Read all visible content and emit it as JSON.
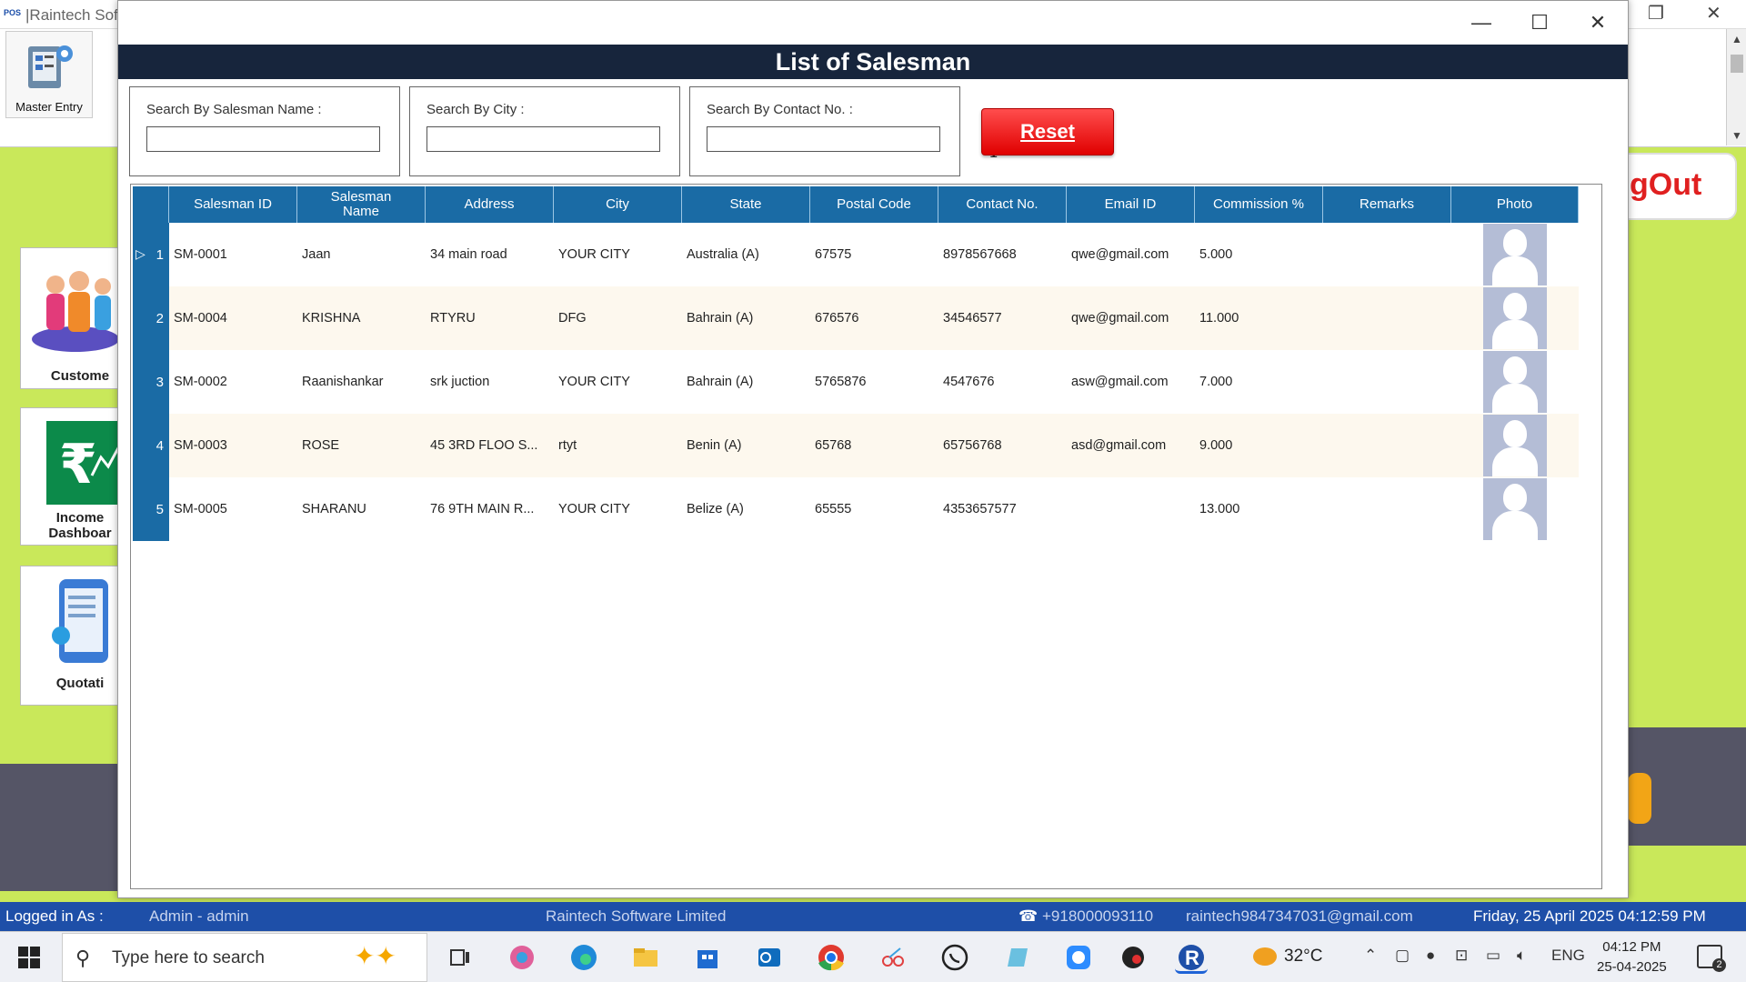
{
  "background_app": {
    "title": "|Raintech Sof",
    "pos_logo": "POS",
    "master_entry_label": "Master Entry",
    "cards": [
      {
        "label": "Custome"
      },
      {
        "label": "Income\nDashboar"
      },
      {
        "label": "Quotati"
      }
    ],
    "logout_label": "gOut"
  },
  "modal": {
    "title": "List of Salesman",
    "search": {
      "name_label": "Search By Salesman Name :",
      "name_value": "",
      "city_label": "Search By City :",
      "city_value": "",
      "contact_label": "Search By Contact No. :",
      "contact_value": ""
    },
    "reset_label": "Reset",
    "columns": [
      "Salesman ID",
      "Salesman Name",
      "Address",
      "City",
      "State",
      "Postal Code",
      "Contact No.",
      "Email ID",
      "Commission %",
      "Remarks",
      "Photo"
    ],
    "rows": [
      {
        "n": "1",
        "id": "SM-0001",
        "name": "Jaan",
        "address": "34 main road",
        "city": "YOUR CITY",
        "state": "Australia (A)",
        "postal": "67575",
        "contact": "8978567668",
        "email": "qwe@gmail.com",
        "commission": "5.000",
        "remarks": ""
      },
      {
        "n": "2",
        "id": "SM-0004",
        "name": "KRISHNA",
        "address": "RTYRU",
        "city": "DFG",
        "state": "Bahrain (A)",
        "postal": "676576",
        "contact": "34546577",
        "email": "qwe@gmail.com",
        "commission": "11.000",
        "remarks": ""
      },
      {
        "n": "3",
        "id": "SM-0002",
        "name": "Raanishankar",
        "address": "srk juction",
        "city": "YOUR CITY",
        "state": "Bahrain (A)",
        "postal": "5765876",
        "contact": "4547676",
        "email": "asw@gmail.com",
        "commission": "7.000",
        "remarks": ""
      },
      {
        "n": "4",
        "id": "SM-0003",
        "name": "ROSE",
        "address": "45 3RD FLOO S...",
        "city": "rtyt",
        "state": "Benin (A)",
        "postal": "65768",
        "contact": "65756768",
        "email": "asd@gmail.com",
        "commission": "9.000",
        "remarks": ""
      },
      {
        "n": "5",
        "id": "SM-0005",
        "name": "SHARANU",
        "address": "76 9TH MAIN R...",
        "city": "YOUR CITY",
        "state": "Belize (A)",
        "postal": "65555",
        "contact": "4353657577",
        "email": "",
        "commission": "13.000",
        "remarks": ""
      }
    ]
  },
  "statusbar": {
    "logged_in": "Logged in As :",
    "user": "Admin - admin",
    "company": "Raintech Software Limited",
    "phone": "+918000093110",
    "email": "raintech9847347031@gmail.com",
    "datetime": "Friday, 25 April 2025 04:12:59 PM"
  },
  "taskbar": {
    "search_placeholder": "Type here to search",
    "weather": "32°C",
    "lang": "ENG",
    "time": "04:12 PM",
    "date": "25-04-2025",
    "notifications": "2"
  },
  "colors": {
    "header_navy": "#17253c",
    "grid_header_blue": "#1a6ba5",
    "reset_red": "#e00000",
    "background_green": "#c9e85a",
    "status_blue": "#1e4fa8"
  }
}
